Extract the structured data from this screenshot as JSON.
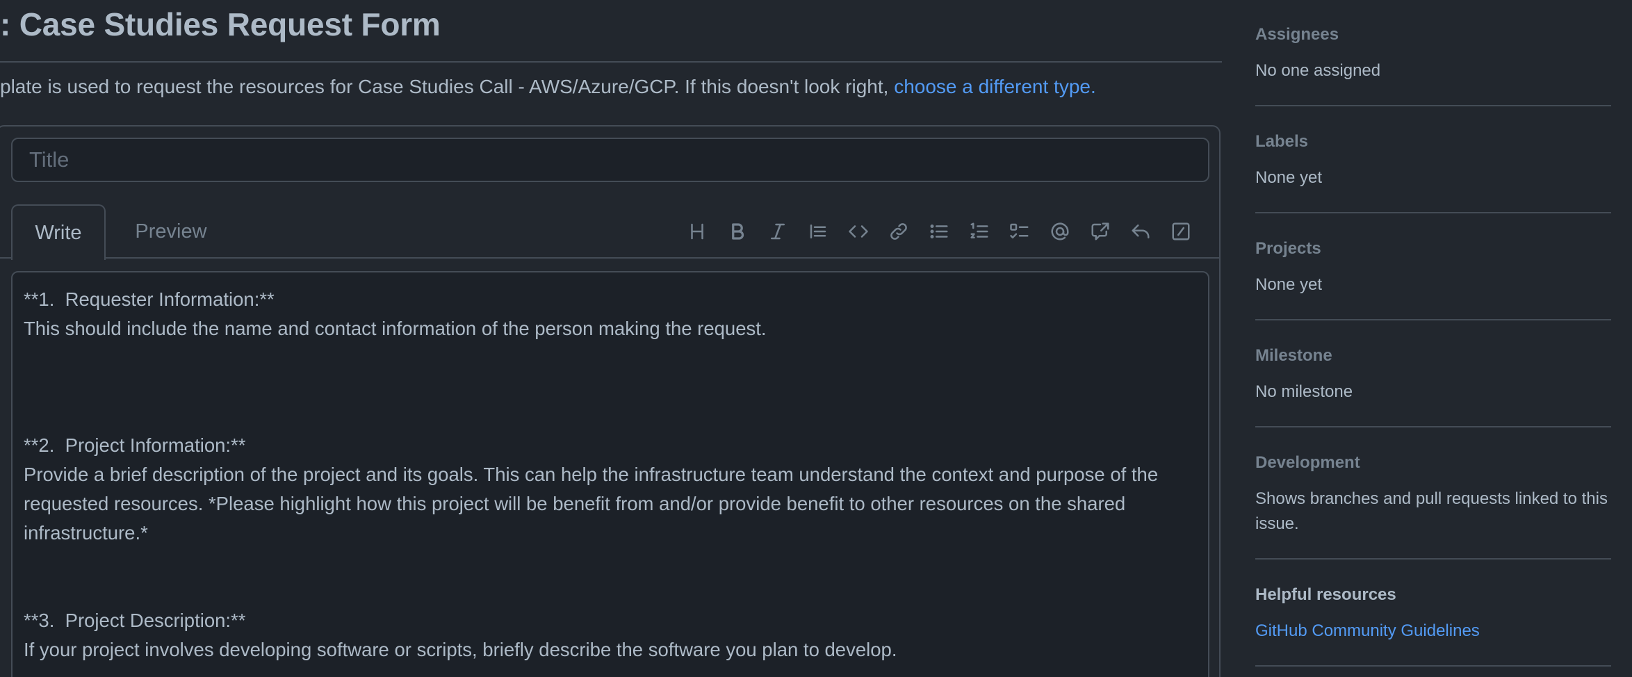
{
  "header": {
    "title": ": Case Studies Request Form",
    "template_note": "plate is used to request the resources for Case Studies Call - AWS/Azure/GCP. If this doesn't look right, ",
    "template_link": "choose a different type."
  },
  "form": {
    "title_placeholder": "Title",
    "tabs": [
      {
        "label": "Write",
        "active": true
      },
      {
        "label": "Preview",
        "active": false
      }
    ],
    "toolbar": [
      "heading-icon",
      "bold-icon",
      "italic-icon",
      "quote-icon",
      "code-icon",
      "link-icon",
      "unordered-list-icon",
      "ordered-list-icon",
      "task-list-icon",
      "mention-icon",
      "cross-reference-icon",
      "saved-reply-icon",
      "slash-command-icon"
    ],
    "body": {
      "s1_heading": "**1.  Requester Information:**",
      "s1_text": "This should include the name and contact information of the person making the request.",
      "s2_heading": "**2.  Project Information:**",
      "s2_text": "Provide a brief description of the project and its goals. This can help the infrastructure team understand the context and purpose of the requested resources. *Please highlight how this project will be benefit from and/or provide benefit to other resources on the shared infrastructure.*",
      "s3_heading": "**3.  Project Description:**",
      "s3_text": "If your project involves developing software or scripts, briefly describe the software you plan to develop."
    }
  },
  "sidebar": {
    "assignees": {
      "heading": "Assignees",
      "value": "No one assigned"
    },
    "labels": {
      "heading": "Labels",
      "value": "None yet"
    },
    "projects": {
      "heading": "Projects",
      "value": "None yet"
    },
    "milestone": {
      "heading": "Milestone",
      "value": "No milestone"
    },
    "development": {
      "heading": "Development",
      "value": "Shows branches and pull requests linked to this issue."
    },
    "helpful": {
      "heading": "Helpful resources",
      "link": "GitHub Community Guidelines"
    }
  },
  "colors": {
    "background": "#22272e",
    "input_background": "#1c2128",
    "border": "#444c56",
    "text": "#adbac7",
    "muted": "#768390",
    "link": "#539bf5"
  }
}
